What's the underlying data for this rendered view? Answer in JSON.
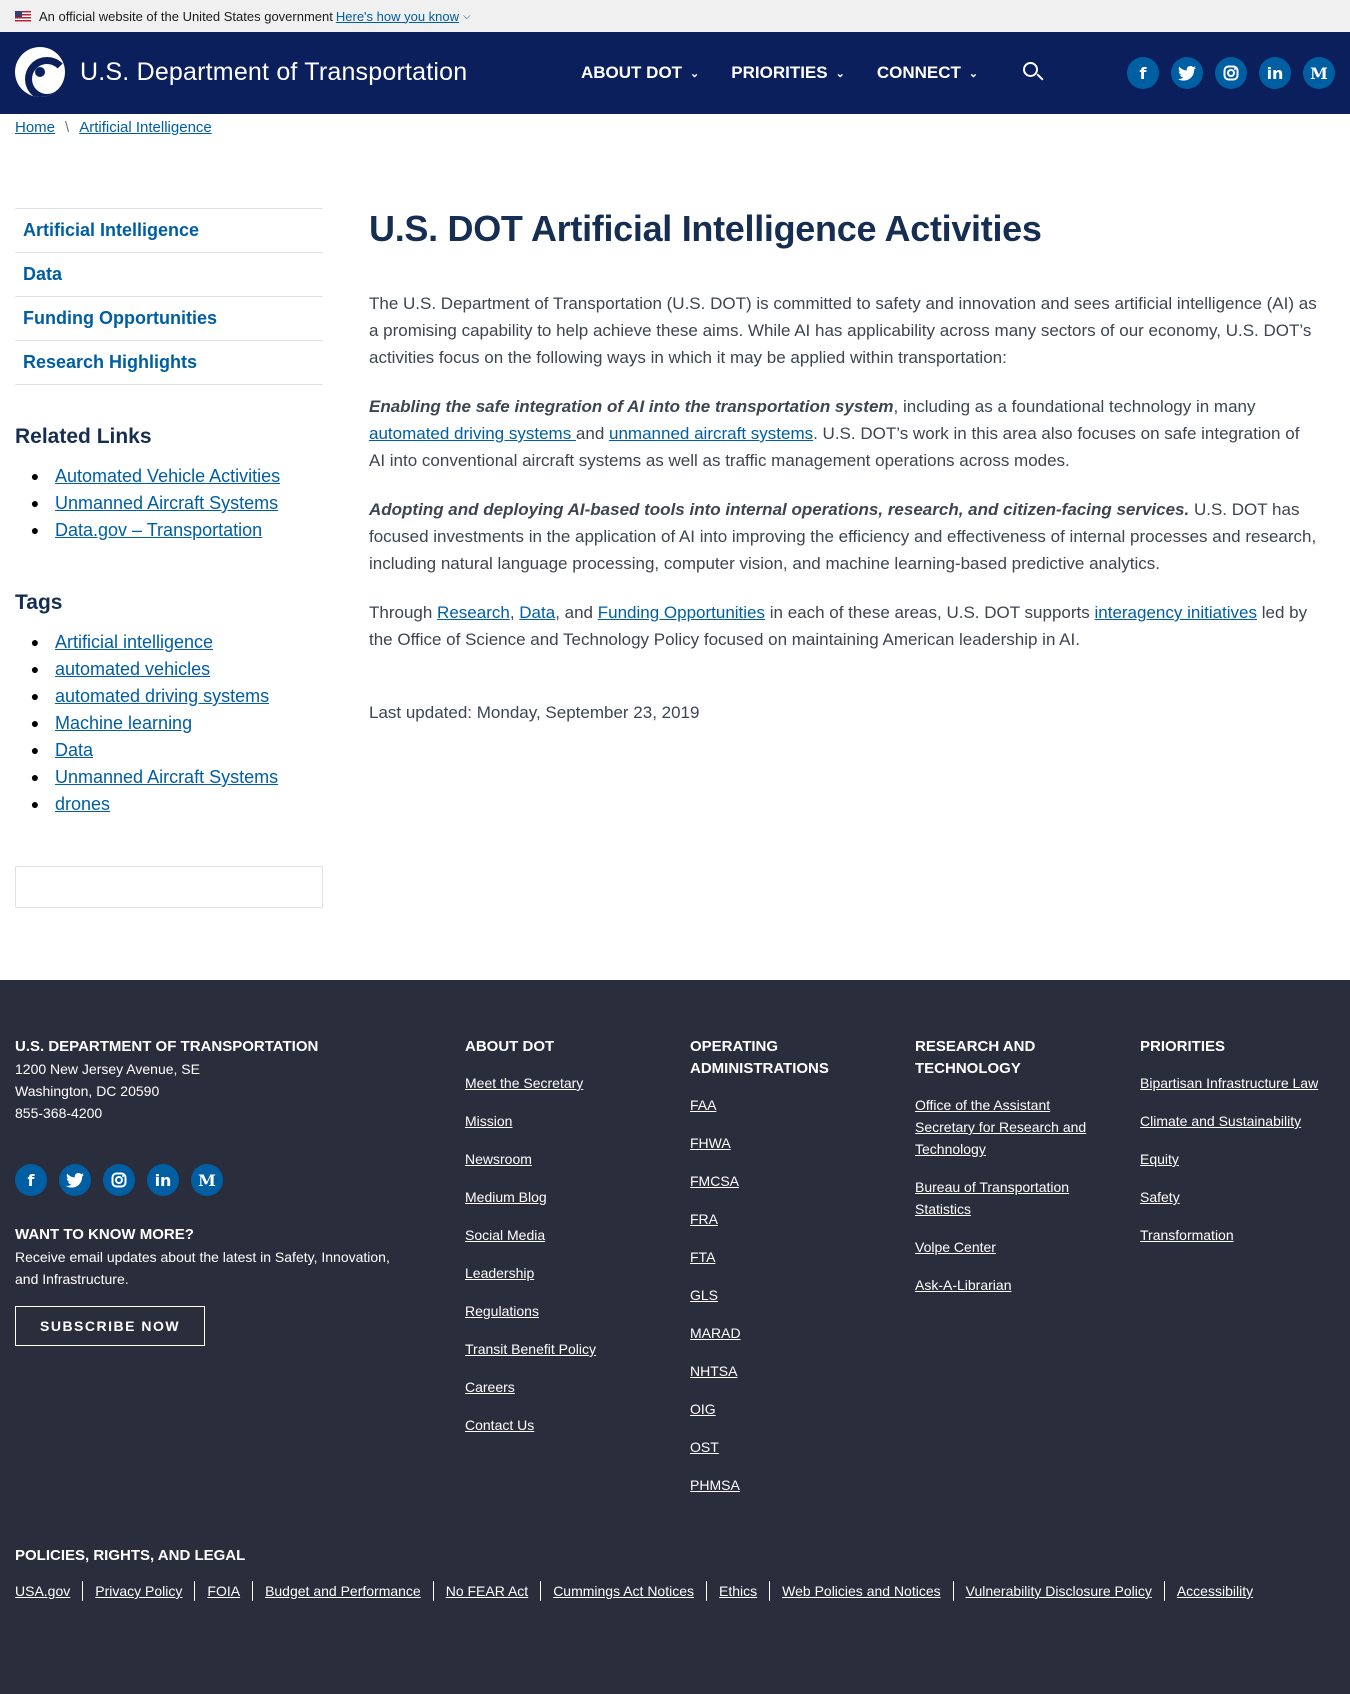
{
  "gov_banner": {
    "text": "An official website of the United States government",
    "link": "Here's how you know"
  },
  "header": {
    "logo_text": "U.S. Department of Transportation",
    "nav": [
      {
        "label": "ABOUT DOT"
      },
      {
        "label": "PRIORITIES"
      },
      {
        "label": "CONNECT"
      }
    ],
    "social": [
      "f",
      "t",
      "ig",
      "in",
      "M"
    ]
  },
  "breadcrumb": {
    "home": "Home",
    "current": "Artificial Intelligence"
  },
  "sidenav": [
    "Artificial Intelligence",
    "Data",
    "Funding Opportunities",
    "Research Highlights"
  ],
  "related": {
    "heading": "Related Links",
    "items": [
      "Automated Vehicle Activities",
      "Unmanned Aircraft Systems",
      "Data.gov – Transportation"
    ]
  },
  "tags": {
    "heading": "Tags",
    "items": [
      "Artificial intelligence",
      "automated vehicles",
      "automated driving systems",
      "Machine learning",
      "Data",
      "Unmanned Aircraft Systems",
      "drones"
    ]
  },
  "main": {
    "title": "U.S. DOT Artificial Intelligence Activities",
    "p1": "The U.S. Department of Transportation (U.S. DOT)  is committed to safety and innovation and sees artificial intelligence (AI) as a promising capability to help achieve these aims. While AI has applicability across many sectors of our economy, U.S. DOT’s activities focus on the following ways in which it may be applied within transportation:",
    "p2_em": "Enabling the safe integration of AI into the transportation system",
    "p2_a": ", including as a foundational technology in many ",
    "p2_link1": "automated driving systems ",
    "p2_b": "and ",
    "p2_link2": "unmanned aircraft systems",
    "p2_c": ". U.S. DOT’s work in this area also focuses on safe integration of AI into conventional aircraft systems as well as traffic management operations across modes.",
    "p3_em": "Adopting and deploying AI-based tools into internal operations, research, and citizen-facing services.",
    "p3_rest": " U.S. DOT has focused investments in the application of AI into improving the efficiency and effectiveness of internal processes and research, including natural language processing, computer vision, and machine learning-based predictive analytics.",
    "p4_a": "Through ",
    "p4_link1": " Research",
    "p4_b": ", ",
    "p4_link2": "Data",
    "p4_c": ", and ",
    "p4_link3": "Funding Opportunities",
    "p4_d": " in each of these areas, U.S. DOT supports ",
    "p4_link4": "interagency initiatives",
    "p4_e": " led by the Office of Science and Technology Policy focused on maintaining American leadership in AI.",
    "updated": "Last updated: Monday, September 23, 2019"
  },
  "footer": {
    "org": {
      "heading": "U.S. DEPARTMENT OF TRANSPORTATION",
      "address1": "1200 New Jersey Avenue, SE",
      "address2": "Washington, DC 20590",
      "phone": "855-368-4200",
      "want_heading": "WANT TO KNOW MORE?",
      "want_text": "Receive email updates about the latest in Safety, Innovation, and Infrastructure.",
      "subscribe": "SUBSCRIBE NOW"
    },
    "about": {
      "heading": "ABOUT DOT",
      "links": [
        "Meet the Secretary",
        "Mission",
        "Newsroom",
        "Medium Blog",
        "Social Media",
        "Leadership",
        "Regulations",
        "Transit Benefit Policy",
        "Careers",
        "Contact Us"
      ]
    },
    "operating": {
      "heading": "OPERATING ADMINISTRATIONS",
      "links": [
        "FAA",
        "FHWA",
        "FMCSA",
        "FRA",
        "FTA",
        "GLS",
        "MARAD",
        "NHTSA",
        "OIG",
        "OST",
        "PHMSA"
      ]
    },
    "research": {
      "heading": "RESEARCH AND TECHNOLOGY",
      "links": [
        "Office of the Assistant Secretary for Research and Technology",
        "Bureau of Transportation Statistics",
        "Volpe Center",
        "Ask-A-Librarian"
      ]
    },
    "priorities": {
      "heading": "PRIORITIES",
      "links": [
        "Bipartisan Infrastructure Law",
        "Climate and Sustainability",
        "Equity",
        "Safety",
        "Transformation"
      ]
    },
    "legal": {
      "heading": "POLICIES, RIGHTS, AND LEGAL",
      "links": [
        "USA.gov",
        "Privacy Policy",
        "FOIA",
        "Budget and Performance",
        "No FEAR Act",
        "Cummings Act Notices",
        "Ethics",
        "Web Policies and Notices",
        "Vulnerability Disclosure Policy",
        "Accessibility"
      ]
    }
  }
}
